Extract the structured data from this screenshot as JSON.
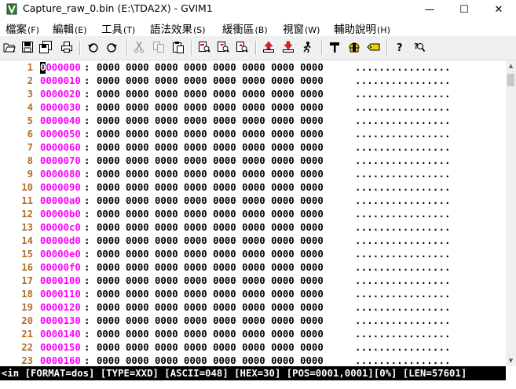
{
  "window": {
    "title": "Capture_raw_0.bin (E:\\TDA2X) - GVIM1",
    "minimize_glyph": "—",
    "maximize_glyph": "☐",
    "close_glyph": "✕"
  },
  "menu": [
    {
      "label": "檔案",
      "accel": "(F)"
    },
    {
      "label": "編輯",
      "accel": "(E)"
    },
    {
      "label": "工具",
      "accel": "(T)"
    },
    {
      "label": "語法效果",
      "accel": "(S)"
    },
    {
      "label": "緩衝區",
      "accel": "(B)"
    },
    {
      "label": "視窗",
      "accel": "(W)"
    },
    {
      "label": "輔助說明",
      "accel": "(H)"
    }
  ],
  "toolbar": [
    "open-icon",
    "save-icon",
    "save-all-icon",
    "print-icon",
    "undo-icon",
    "redo-icon",
    "cut-icon",
    "copy-icon",
    "paste-icon",
    "find-replace-icon",
    "find-next-icon",
    "find-prev-icon",
    "load-session-icon",
    "save-session-icon",
    "run-script-icon",
    "make-icon",
    "shell-icon",
    "tags-icon",
    "help-icon",
    "find-help-icon"
  ],
  "editor": {
    "lines": [
      {
        "num": "1",
        "addr": "0000000",
        "hex": "0000 0000 0000 0000 0000 0000 0000 0000",
        "ascii": "................"
      },
      {
        "num": "2",
        "addr": "0000010",
        "hex": "0000 0000 0000 0000 0000 0000 0000 0000",
        "ascii": "................"
      },
      {
        "num": "3",
        "addr": "0000020",
        "hex": "0000 0000 0000 0000 0000 0000 0000 0000",
        "ascii": "................"
      },
      {
        "num": "4",
        "addr": "0000030",
        "hex": "0000 0000 0000 0000 0000 0000 0000 0000",
        "ascii": "................"
      },
      {
        "num": "5",
        "addr": "0000040",
        "hex": "0000 0000 0000 0000 0000 0000 0000 0000",
        "ascii": "................"
      },
      {
        "num": "6",
        "addr": "0000050",
        "hex": "0000 0000 0000 0000 0000 0000 0000 0000",
        "ascii": "................"
      },
      {
        "num": "7",
        "addr": "0000060",
        "hex": "0000 0000 0000 0000 0000 0000 0000 0000",
        "ascii": "................"
      },
      {
        "num": "8",
        "addr": "0000070",
        "hex": "0000 0000 0000 0000 0000 0000 0000 0000",
        "ascii": "................"
      },
      {
        "num": "9",
        "addr": "0000080",
        "hex": "0000 0000 0000 0000 0000 0000 0000 0000",
        "ascii": "................"
      },
      {
        "num": "10",
        "addr": "0000090",
        "hex": "0000 0000 0000 0000 0000 0000 0000 0000",
        "ascii": "................"
      },
      {
        "num": "11",
        "addr": "00000a0",
        "hex": "0000 0000 0000 0000 0000 0000 0000 0000",
        "ascii": "................"
      },
      {
        "num": "12",
        "addr": "00000b0",
        "hex": "0000 0000 0000 0000 0000 0000 0000 0000",
        "ascii": "................"
      },
      {
        "num": "13",
        "addr": "00000c0",
        "hex": "0000 0000 0000 0000 0000 0000 0000 0000",
        "ascii": "................"
      },
      {
        "num": "14",
        "addr": "00000d0",
        "hex": "0000 0000 0000 0000 0000 0000 0000 0000",
        "ascii": "................"
      },
      {
        "num": "15",
        "addr": "00000e0",
        "hex": "0000 0000 0000 0000 0000 0000 0000 0000",
        "ascii": "................"
      },
      {
        "num": "16",
        "addr": "00000f0",
        "hex": "0000 0000 0000 0000 0000 0000 0000 0000",
        "ascii": "................"
      },
      {
        "num": "17",
        "addr": "0000100",
        "hex": "0000 0000 0000 0000 0000 0000 0000 0000",
        "ascii": "................"
      },
      {
        "num": "18",
        "addr": "0000110",
        "hex": "0000 0000 0000 0000 0000 0000 0000 0000",
        "ascii": "................"
      },
      {
        "num": "19",
        "addr": "0000120",
        "hex": "0000 0000 0000 0000 0000 0000 0000 0000",
        "ascii": "................"
      },
      {
        "num": "20",
        "addr": "0000130",
        "hex": "0000 0000 0000 0000 0000 0000 0000 0000",
        "ascii": "................"
      },
      {
        "num": "21",
        "addr": "0000140",
        "hex": "0000 0000 0000 0000 0000 0000 0000 0000",
        "ascii": "................"
      },
      {
        "num": "22",
        "addr": "0000150",
        "hex": "0000 0000 0000 0000 0000 0000 0000 0000",
        "ascii": "................"
      },
      {
        "num": "23",
        "addr": "0000160",
        "hex": "0000 0000 0000 0000 0000 0000 0000 0000",
        "ascii": "................"
      }
    ]
  },
  "statusline": "<in [FORMAT=dos] [TYPE=XXD] [ASCII=048] [HEX=30] [POS=0001,0001][0%] [LEN=57601]",
  "colors": {
    "line_number": "#b07028",
    "address": "#ff00ff",
    "status_bg": "#000000",
    "status_fg": "#ffffff"
  }
}
